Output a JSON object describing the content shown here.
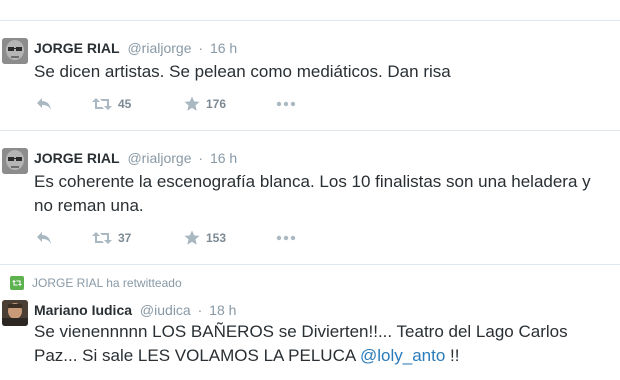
{
  "tweets": [
    {
      "name": "JORGE RIAL",
      "handle": "@rialjorge",
      "dot": "·",
      "time": "16 h",
      "text": "Se dicen artistas. Se pelean como mediáticos. Dan risa",
      "retweets": "45",
      "favorites": "176"
    },
    {
      "name": "JORGE RIAL",
      "handle": "@rialjorge",
      "dot": "·",
      "time": "16 h",
      "text": "Es coherente la escenografía blanca. Los 10 finalistas son una heladera y no reman una.",
      "retweets": "37",
      "favorites": "153"
    },
    {
      "retweet_context": "JORGE RIAL ha retwitteado",
      "name": "Mariano Iudica",
      "handle": "@iudica",
      "dot": "·",
      "time": "18 h",
      "text_part1": "Se vienennnnn LOS BAÑEROS se Divierten!!... Teatro del Lago Carlos Paz... Si sale LES VOLAMOS LA PELUCA ",
      "mention": "@loly_anto",
      "text_part2": " !!"
    }
  ],
  "colors": {
    "link": "#2b7bb9",
    "icon": "#aab8c2",
    "retweet_badge": "#5eb14f"
  },
  "icons": [
    "reply-icon",
    "retweet-icon",
    "favorite-star-icon",
    "more-dots-icon"
  ]
}
